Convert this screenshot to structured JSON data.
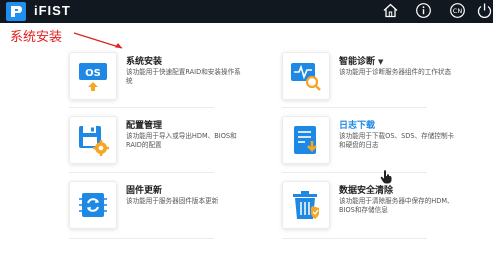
{
  "topbar": {
    "app_name": "iFIST",
    "icons": [
      "home-icon",
      "info-icon",
      "language-cn-icon",
      "power-icon"
    ],
    "language_label": "CN"
  },
  "annotation": {
    "label": "系统安装",
    "color": "#e02020"
  },
  "cards": [
    {
      "title": "系统安装",
      "desc": "该功能用于快速配置RAID和安装操作系统",
      "icon": "os-install-icon"
    },
    {
      "title": "智能诊断",
      "desc": "该功能用于诊断服务器组件的工作状态",
      "icon": "diagnosis-icon",
      "has_dropdown": true
    },
    {
      "title": "配置管理",
      "desc": "该功能用于导入或导出HDM、BIOS和RAID的配置",
      "icon": "config-icon"
    },
    {
      "title": "日志下载",
      "desc": "该功能用于下载OS、SDS、存储控制卡和硬盘的日志",
      "icon": "log-download-icon",
      "highlighted": true
    },
    {
      "title": "固件更新",
      "desc": "该功能用于服务器固件版本更新",
      "icon": "firmware-update-icon"
    },
    {
      "title": "数据安全清除",
      "desc": "该功能用于清除服务器中保存的HDM、BIOS和存储信息",
      "icon": "secure-erase-icon"
    }
  ],
  "colors": {
    "topbar": "#121820",
    "accent": "#1e88e5",
    "icon_orange": "#f5a623"
  }
}
